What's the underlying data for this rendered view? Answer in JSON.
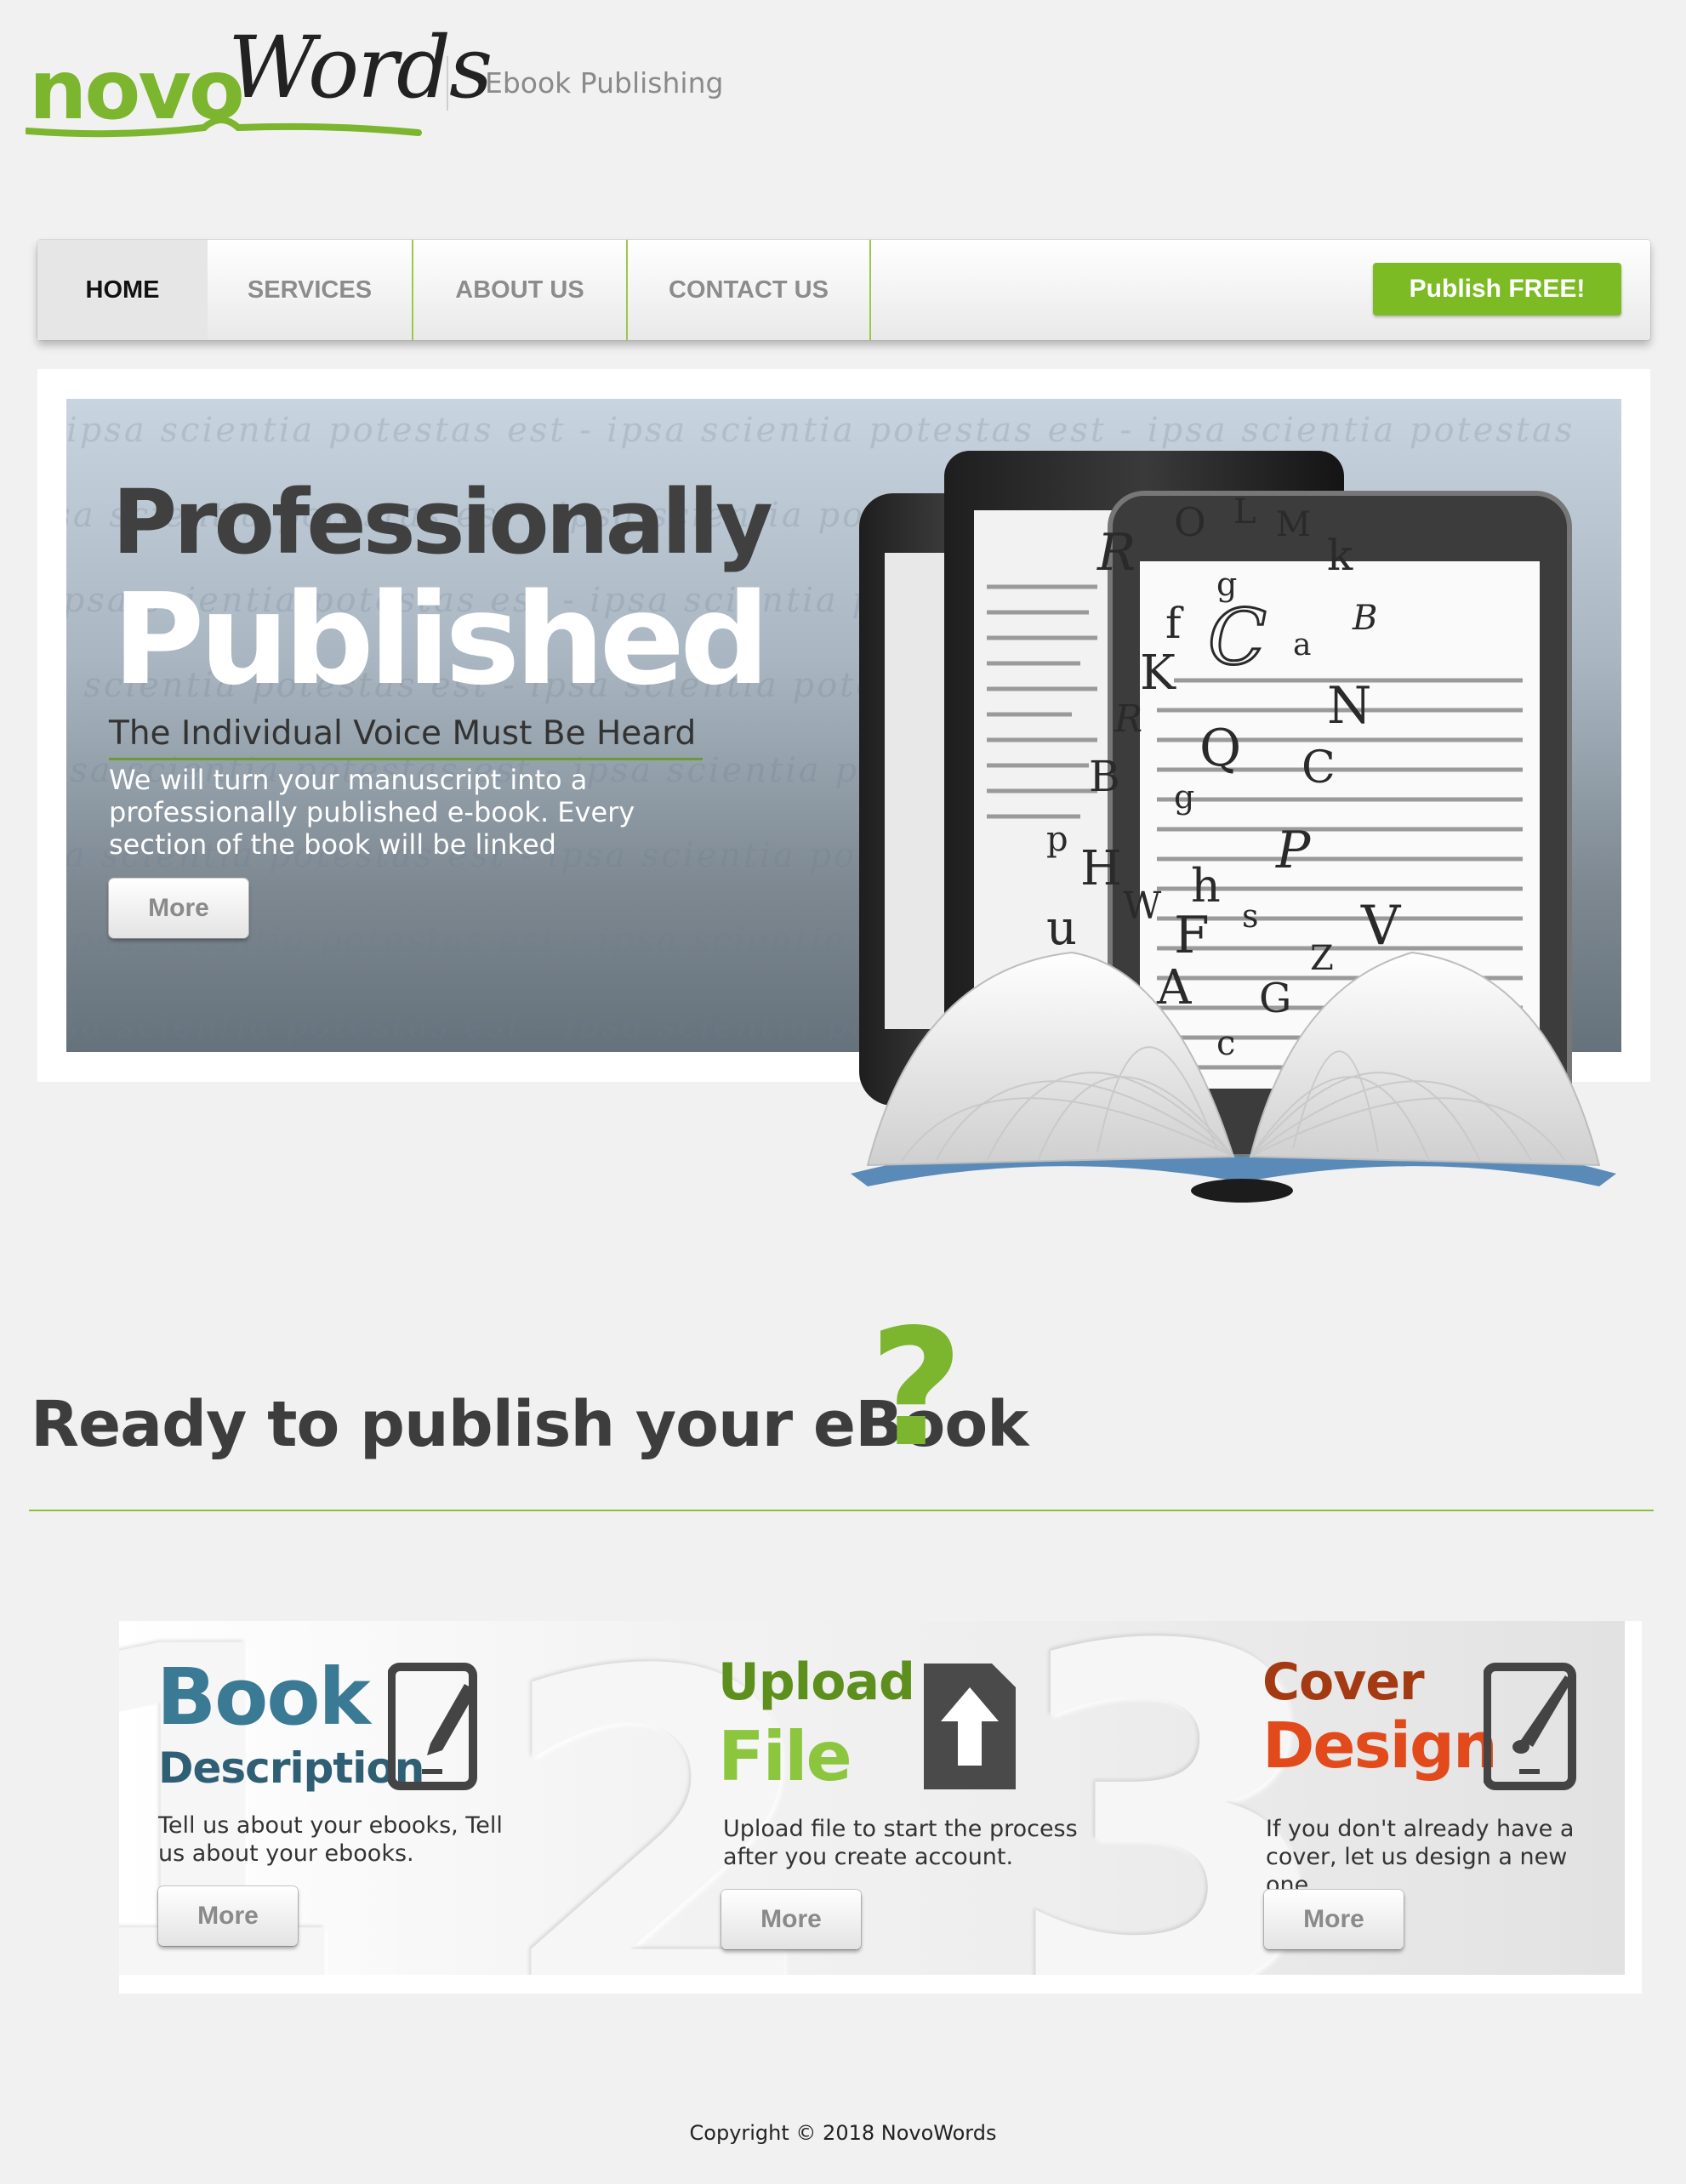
{
  "brand": {
    "logo_part1": "novo",
    "logo_part2": "Words",
    "tagline": "Ebook Publishing",
    "accent": "#7cb52e"
  },
  "nav": {
    "items": [
      {
        "label": "HOME",
        "active": true
      },
      {
        "label": "SERVICES",
        "active": false
      },
      {
        "label": "ABOUT US",
        "active": false
      },
      {
        "label": "CONTACT US",
        "active": false
      }
    ],
    "cta": "Publish FREE!"
  },
  "hero": {
    "title_line1": "Professionally",
    "title_line2": "Published",
    "subtitle": "The Individual Voice Must Be Heard",
    "description": "We will turn your manuscript into a professionally published e-book. Every section of the book will be linked",
    "more": "More",
    "background_script": "ipsa scientia potestas est - ipsa scientia potestas est - ipsa scientia potestas"
  },
  "ready": {
    "heading": "Ready to publish your eBook",
    "mark": "?"
  },
  "steps": [
    {
      "number": "1",
      "title_line1": "Book",
      "title_line2": "Description",
      "color": "#3a7a94",
      "color2": "#2e5f74",
      "text": "Tell us about your ebooks, Tell us about your ebooks.",
      "more": "More",
      "icon": "pencil-tablet-icon"
    },
    {
      "number": "2",
      "title_line1": "Upload",
      "title_line2": "File",
      "color": "#5d8f1c",
      "color2": "#8cc63f",
      "text": "Upload file to start the process after you create account.",
      "more": "More",
      "icon": "upload-file-icon"
    },
    {
      "number": "3",
      "title_line1": "Cover",
      "title_line2": "Design",
      "color": "#a33a12",
      "color2": "#e24a1c",
      "text": "If you don't already have a cover, let us design a new one.",
      "more": "More",
      "icon": "brush-tablet-icon"
    }
  ],
  "footer": {
    "copyright": "Copyright © 2018 NovoWords"
  }
}
